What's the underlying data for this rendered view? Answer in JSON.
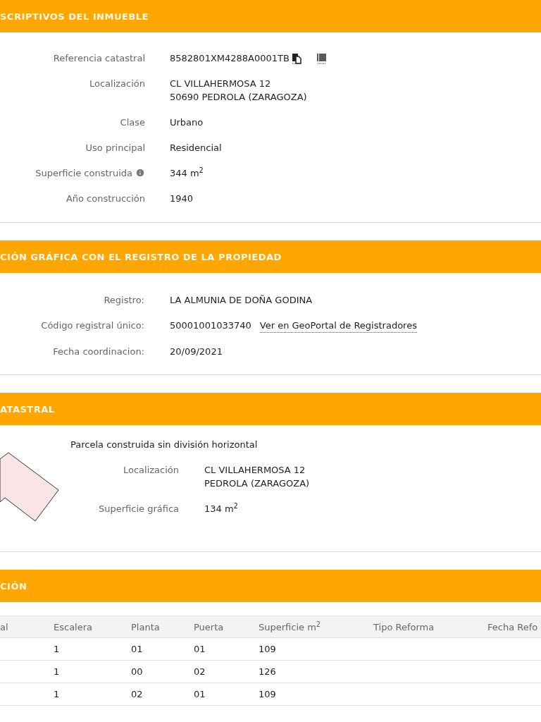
{
  "datos": {
    "title": "SCRIPTIVOS DEL INMUEBLE",
    "fields": [
      {
        "label": "Referencia catastral",
        "lines": [
          "8582801XM4288A0001TB"
        ],
        "kind": "reference"
      },
      {
        "label": "Localización",
        "lines": [
          "CL VILLAHERMOSA 12",
          "50690 PEDROLA (ZARAGOZA)"
        ],
        "kind": "text"
      },
      {
        "label": "Clase",
        "lines": [
          "Urbano"
        ],
        "kind": "text"
      },
      {
        "label": "Uso principal",
        "lines": [
          "Residencial"
        ],
        "kind": "text"
      },
      {
        "label": "Superficie construida",
        "lines": [
          "344 m$^{2}$"
        ],
        "kind": "info"
      },
      {
        "label": "Año construcción",
        "lines": [
          "1940"
        ],
        "kind": "text"
      }
    ]
  },
  "registro": {
    "title": "CIÓN GRÁFICA CON EL REGISTRO DE LA PROPIEDAD",
    "fields": [
      {
        "label": "Registro:",
        "value": "LA ALMUNIA DE DOÑA GODINA"
      },
      {
        "label": "Código registral único:",
        "value": "50001001033740",
        "link": "Ver en GeoPortal de Registradores"
      },
      {
        "label": "Fecha coordinacion:",
        "value": "20/09/2021"
      }
    ]
  },
  "parcela": {
    "title": "ATASTRAL",
    "subtitle": "Parcela construida sin división horizontal",
    "fields": [
      {
        "label": "Localización",
        "lines": [
          "CL VILLAHERMOSA 12",
          "PEDROLA (ZARAGOZA)"
        ]
      },
      {
        "label": "Superficie gráfica",
        "lines": [
          "134 m$^{2}$"
        ]
      }
    ]
  },
  "construccion": {
    "title": "CIÓN",
    "table": {
      "columns": [
        "al",
        "Escalera",
        "Planta",
        "Puerta",
        "Superficie m$^{2}$",
        "Tipo Reforma",
        "Fecha Refo"
      ],
      "rows": [
        [
          "",
          "1",
          "01",
          "01",
          "109",
          "",
          ""
        ],
        [
          "",
          "1",
          "00",
          "02",
          "126",
          "",
          ""
        ],
        [
          "",
          "1",
          "02",
          "01",
          "109",
          "",
          ""
        ]
      ]
    }
  }
}
